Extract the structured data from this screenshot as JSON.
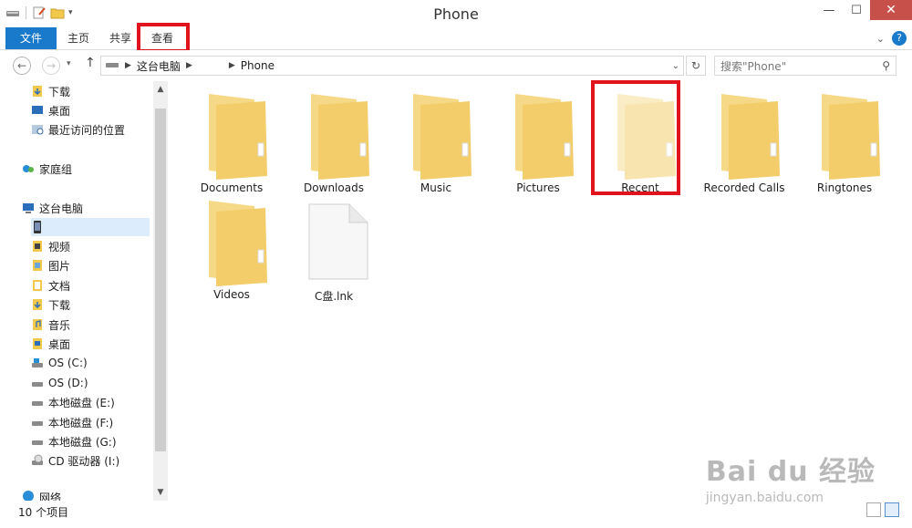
{
  "window": {
    "title": "Phone"
  },
  "ribbon": {
    "tabs": [
      {
        "label": "文件"
      },
      {
        "label": "主页"
      },
      {
        "label": "共享"
      },
      {
        "label": "查看"
      }
    ]
  },
  "address": {
    "crumbs": [
      "这台电脑",
      "Phone"
    ],
    "search_placeholder": "搜索\"Phone\""
  },
  "nav": {
    "items": [
      {
        "label": "下载"
      },
      {
        "label": "桌面"
      },
      {
        "label": "最近访问的位置"
      },
      {
        "label": "家庭组"
      },
      {
        "label": "这台电脑"
      },
      {
        "label": ""
      },
      {
        "label": "视频"
      },
      {
        "label": "图片"
      },
      {
        "label": "文档"
      },
      {
        "label": "下载"
      },
      {
        "label": "音乐"
      },
      {
        "label": "桌面"
      },
      {
        "label": "OS (C:)"
      },
      {
        "label": "OS (D:)"
      },
      {
        "label": "本地磁盘 (E:)"
      },
      {
        "label": "本地磁盘 (F:)"
      },
      {
        "label": "本地磁盘 (G:)"
      },
      {
        "label": "CD 驱动器 (I:)"
      },
      {
        "label": "网络"
      }
    ]
  },
  "content": {
    "items": [
      {
        "label": "Documents",
        "type": "folder"
      },
      {
        "label": "Downloads",
        "type": "folder"
      },
      {
        "label": "Music",
        "type": "folder"
      },
      {
        "label": "Pictures",
        "type": "folder"
      },
      {
        "label": "Recent",
        "type": "folder"
      },
      {
        "label": "Recorded Calls",
        "type": "folder"
      },
      {
        "label": "Ringtones",
        "type": "folder"
      },
      {
        "label": "Videos",
        "type": "folder"
      },
      {
        "label": "C盘.lnk",
        "type": "file"
      }
    ]
  },
  "status": {
    "count": "10 个项目"
  },
  "watermark": {
    "brand": "Bai du 经验",
    "url": "jingyan.baidu.com"
  },
  "colors": {
    "file_tab": "#1979ca",
    "highlight": "#e1141e",
    "close_button": "#c7504a",
    "folder": "#f5d987"
  }
}
